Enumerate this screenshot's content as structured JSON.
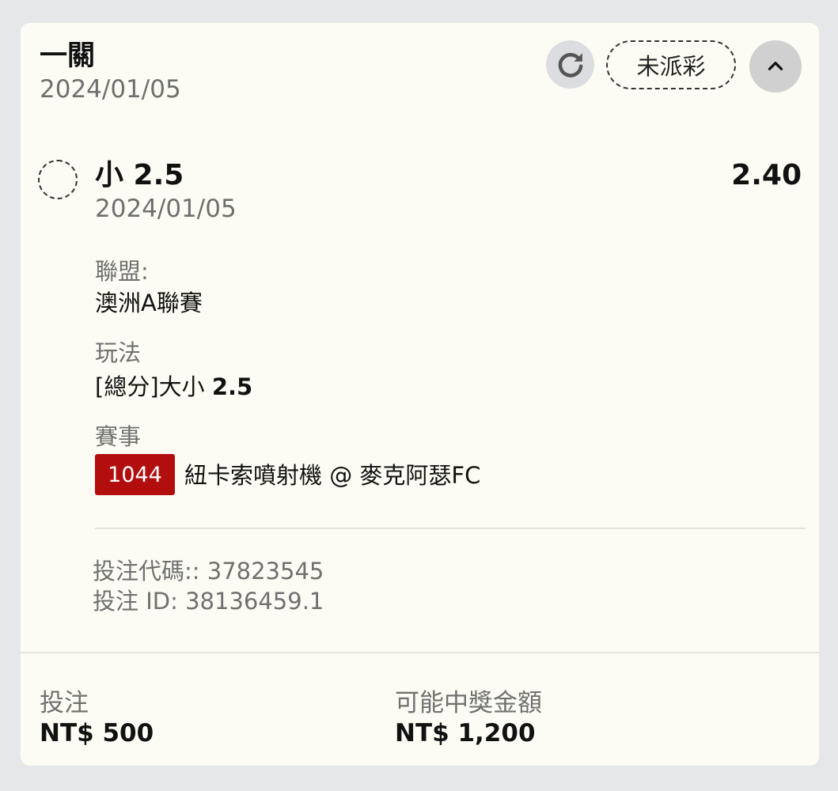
{
  "header": {
    "title": "一關",
    "date": "2024/01/05",
    "status": "未派彩"
  },
  "selection": {
    "name": "小 2.5",
    "odds": "2.40",
    "date": "2024/01/05"
  },
  "details": {
    "league_label": "聯盟:",
    "league_value": "澳洲A聯賽",
    "market_label": "玩法",
    "market_value_prefix": "[總分]大小",
    "market_value_line": "2.5",
    "event_label": "賽事",
    "event_id": "1044",
    "event_name": "紐卡索噴射機 @ 麥克阿瑟FC"
  },
  "codes": {
    "bet_code": "投注代碼:: 37823545",
    "bet_id": "投注 ID: 38136459.1"
  },
  "footer": {
    "stake_label": "投注",
    "stake_value": "NT$ 500",
    "payout_label": "可能中獎金額",
    "payout_value": "NT$ 1,200"
  },
  "icons": {
    "refresh": "refresh-icon",
    "collapse": "chevron-up-icon"
  },
  "colors": {
    "card_bg": "#fdfcf4",
    "badge_red": "#b30e0e"
  }
}
